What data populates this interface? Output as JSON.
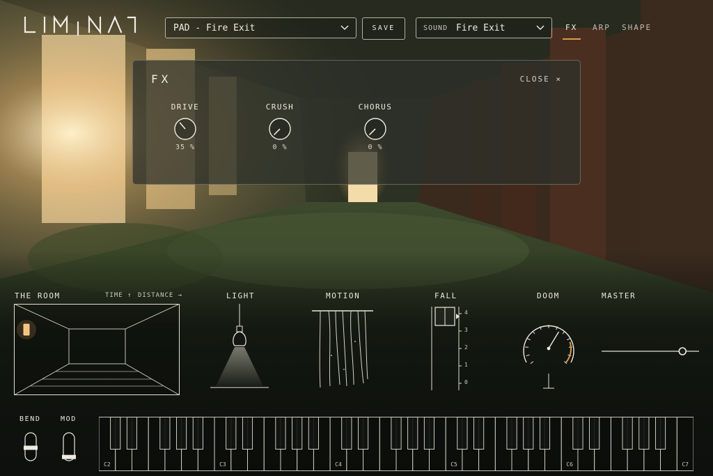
{
  "header": {
    "logo_text": "LIMINAL",
    "preset_selector": {
      "category": "PAD",
      "separator": "-",
      "name": "Fire Exit",
      "display": "PAD - Fire Exit"
    },
    "save_label": "SAVE",
    "sound_selector": {
      "prefix": "SOUND",
      "value": "Fire Exit"
    },
    "tabs": [
      {
        "label": "FX",
        "active": true
      },
      {
        "label": "ARP",
        "active": false
      },
      {
        "label": "SHAPE",
        "active": false
      }
    ]
  },
  "fx_panel": {
    "title": "FX",
    "close_label": "CLOSE",
    "knobs": [
      {
        "label": "DRIVE",
        "value_text": "35 %",
        "value": 0.35
      },
      {
        "label": "CRUSH",
        "value_text": "0 %",
        "value": 0
      },
      {
        "label": "CHORUS",
        "value_text": "0 %",
        "value": 0
      }
    ]
  },
  "modules": {
    "room": {
      "title": "THE ROOM",
      "time_label": "TIME ↑",
      "distance_label": "DISTANCE →"
    },
    "light": {
      "title": "LIGHT"
    },
    "motion": {
      "title": "MOTION"
    },
    "fall": {
      "title": "FALL",
      "scale": [
        "4",
        "3",
        "2",
        "1",
        "0"
      ],
      "value": 4
    },
    "doom": {
      "title": "DOOM",
      "value": 0.62
    },
    "master": {
      "title": "MASTER",
      "value": 0.83
    }
  },
  "controls": {
    "bend_label": "BEND",
    "mod_label": "MOD",
    "bend_value": 0.5,
    "mod_value": 0.1
  },
  "keyboard": {
    "octave_labels": [
      "C2",
      "C3",
      "C4",
      "C5",
      "C6",
      "C7"
    ]
  },
  "colors": {
    "accent": "#d89a52",
    "panel": "#2c302a",
    "line": "#e8e4da"
  }
}
